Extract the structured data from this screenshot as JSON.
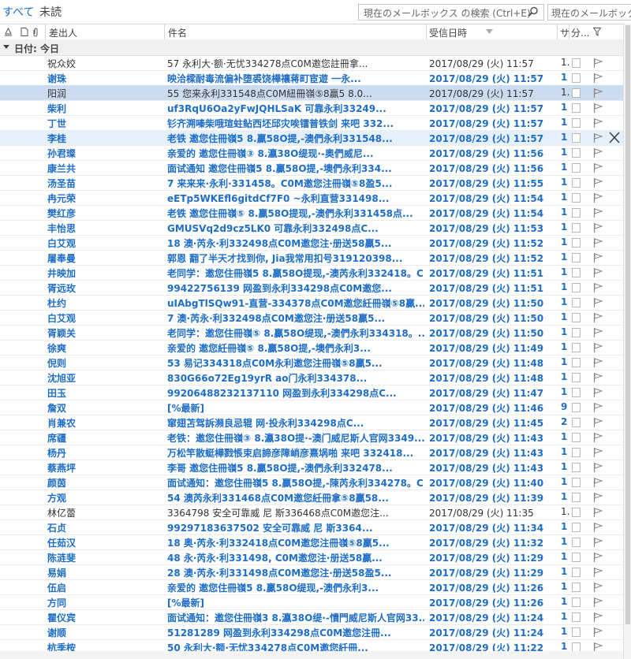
{
  "filters": {
    "all": "すべて",
    "unread": "未読"
  },
  "search": {
    "placeholder": "現在のメールボックス の検索 (Ctrl+E)",
    "scope": "現在のメールボックス"
  },
  "columns": {
    "sender": "差出人",
    "subject": "件名",
    "received": "受信日時",
    "size": "サ",
    "category": "分..."
  },
  "group": {
    "label": "日付: 今日"
  },
  "rows": [
    {
      "sender": "祝众姣",
      "subject": "57             永利大·额·无忧334278点C0M邀您註冊拿...",
      "date": "2017/08/29 (火) 11:57",
      "size": "1.",
      "unread": false
    },
    {
      "sender": "谢珠",
      "subject": "映洽樑耐毒流偏补堕裘饶樺禳蒋町宦遊             一永...",
      "date": "2017/08/29 (火) 11:57",
      "size": "1",
      "unread": true
    },
    {
      "sender": "阳润",
      "subject": "55              您来永利331548点C0M紐冊嶺⑤8贏5 8.0...",
      "date": "2017/08/29 (火) 11:57",
      "size": "1.",
      "unread": false,
      "state": "sel"
    },
    {
      "sender": "柴利",
      "subject": "uf3RqU6Oa2yFwJQHLSaK          可靠永利33249...",
      "date": "2017/08/29 (火) 11:57",
      "size": "1",
      "unread": true
    },
    {
      "sender": "丁世",
      "subject": "钐齐溯嗪柴哦瑄蛀鲇西坯邱灾唉镭普铁剑         来吧 332...",
      "date": "2017/08/29 (火) 11:57",
      "size": "1",
      "unread": true
    },
    {
      "sender": "李桂",
      "subject": "老铁          邀您住冊嶺5 8.贏58O提,-澳們永利331548...",
      "date": "2017/08/29 (火) 11:57",
      "size": "1",
      "unread": true,
      "state": "hov"
    },
    {
      "sender": "孙君璨",
      "subject": "亲爱的           邀您住冊嶺③ 8.瀛38O缇现·-奧們威尼...",
      "date": "2017/08/29 (火) 11:56",
      "size": "1",
      "unread": true
    },
    {
      "sender": "康兰共",
      "subject": "面试通知          邀您住冊嶺5 8.贏58O提,-墺們永利334...",
      "date": "2017/08/29 (火) 11:56",
      "size": "1",
      "unread": true
    },
    {
      "sender": "汤圣苗",
      "subject": "7         来来来·永利·331458。C0M邀您注冊嶺⑤8盈5...",
      "date": "2017/08/29 (火) 11:55",
      "size": "1",
      "unread": true
    },
    {
      "sender": "冉元荣",
      "subject": "eETp5WKEfl6gitdCf7F0            ~永利直营331498...",
      "date": "2017/08/29 (火) 11:54",
      "size": "1",
      "unread": true
    },
    {
      "sender": "樊红彦",
      "subject": "老铁      邀您住冊嶺⑤ 8.贏58O提现,-澳們永利331458点...",
      "date": "2017/08/29 (火) 11:54",
      "size": "1",
      "unread": true
    },
    {
      "sender": "丰怡思",
      "subject": "GMUSVq2d9cz5LK0             可靠永利332498点C...",
      "date": "2017/08/29 (火) 11:53",
      "size": "1",
      "unread": true
    },
    {
      "sender": "白艾观",
      "subject": "18          澳·芮永·利332498点C0M邀您注·册送58贏5...",
      "date": "2017/08/29 (火) 11:52",
      "size": "1",
      "unread": true
    },
    {
      "sender": "屠奉曼",
      "subject": "郭恩        翻了半天才找到你, Jia我常用扣号319120398...",
      "date": "2017/08/29 (火) 11:52",
      "size": "1",
      "unread": true
    },
    {
      "sender": "井映加",
      "subject": "老同学：邀您住冊嶺5 8.贏58O提现,-澳芮永利332418。C...",
      "date": "2017/08/29 (火) 11:51",
      "size": "1",
      "unread": true
    },
    {
      "sender": "胥远玫",
      "subject": "99422756139              网盈到永利334298点C0M邀您...",
      "date": "2017/08/29 (火) 11:51",
      "size": "1",
      "unread": true
    },
    {
      "sender": "杜约",
      "subject": "uIAbgTlSQw91-直营-334378点C0M邀您紝冊嶺⑤8贏...",
      "date": "2017/08/29 (火) 11:50",
      "size": "1",
      "unread": true
    },
    {
      "sender": "白艾观",
      "subject": "7          澳·芮永·利332498点C0M邀您注·册送58贏5...",
      "date": "2017/08/29 (火) 11:50",
      "size": "1",
      "unread": true
    },
    {
      "sender": "胥颖关",
      "subject": "老同学：邀您住冊嶺⑤ 8.贏58O缇现,-澳們永利334318。...",
      "date": "2017/08/29 (火) 11:50",
      "size": "1",
      "unread": true
    },
    {
      "sender": "徐爽",
      "subject": "亲爱的            邀您紝冊嶺⑤ 8.贏58O提,-墺們永利3...",
      "date": "2017/08/29 (火) 11:49",
      "size": "1",
      "unread": true
    },
    {
      "sender": "倪则",
      "subject": "53              易记334318点C0M永利邀您注冊嶺⑤8贏5...",
      "date": "2017/08/29 (火) 11:48",
      "size": "1",
      "unread": true
    },
    {
      "sender": "沈旭亚",
      "subject": "830G66o72Eg19yrR             ao门永利334378...",
      "date": "2017/08/29 (火) 11:48",
      "size": "1",
      "unread": true
    },
    {
      "sender": "田玉",
      "subject": "99206488232137110           网盈到永利334298点C...",
      "date": "2017/08/29 (火) 11:47",
      "size": "1",
      "unread": true
    },
    {
      "sender": "詹双",
      "subject": "[%最新]",
      "date": "2017/08/29 (火) 11:46",
      "size": "9",
      "unread": true
    },
    {
      "sender": "肖兼农",
      "subject": "窜翅苫驾訴瀕良忌辊             网·投永利334298点C...",
      "date": "2017/08/29 (火) 11:45",
      "size": "2",
      "unread": true
    },
    {
      "sender": "席疆",
      "subject": "老铁：邀您住冊嶺③ 8.瀛38O提·-澳门威尼斯人官网3349...",
      "date": "2017/08/29 (火) 11:43",
      "size": "1",
      "unread": true
    },
    {
      "sender": "杨丹",
      "subject": "万松竿散蜓樺戮悵束启諦彦障峭彦熹埚啪       来吧 332418...",
      "date": "2017/08/29 (火) 11:43",
      "size": "1",
      "unread": true
    },
    {
      "sender": "蔡燕坪",
      "subject": "李哥          邀您住冊嶺5 8.贏58O提,-澳們永利332478...",
      "date": "2017/08/29 (火) 11:43",
      "size": "1",
      "unread": true
    },
    {
      "sender": "颜茵",
      "subject": "面试通知：邀您住冊嶺5 8.贏58O提,-陳芮永利334278。C...",
      "date": "2017/08/29 (火) 11:40",
      "size": "1",
      "unread": true
    },
    {
      "sender": "方观",
      "subject": "54              澳芮永利331468点C0M邀您紝冊拿⑤8贏58...",
      "date": "2017/08/29 (火) 11:39",
      "size": "1",
      "unread": true
    },
    {
      "sender": "林亿蕾",
      "subject": "3364798       安全可靠威  尼   斯336468点C0M邀您注...",
      "date": "2017/08/29 (火) 11:35",
      "size": "1.",
      "unread": false
    },
    {
      "sender": "石贞",
      "subject": "99297183637502           安全可靠威  尼   斯3364...",
      "date": "2017/08/29 (火) 11:34",
      "size": "1",
      "unread": true
    },
    {
      "sender": "任茹汉",
      "subject": "18           奥·芮永·利332418点C0M邀您注冊嶺⑤8贏5...",
      "date": "2017/08/29 (火) 11:32",
      "size": "1",
      "unread": true
    },
    {
      "sender": "陈涟斐",
      "subject": "48          永·芮永·利331498, C0M邀您注·册送58贏...",
      "date": "2017/08/29 (火) 11:29",
      "size": "1",
      "unread": true
    },
    {
      "sender": "易娟",
      "subject": "28          澳·芮永·利331498点C0M邀您注·册送58盈5...",
      "date": "2017/08/29 (火) 11:29",
      "size": "1",
      "unread": true
    },
    {
      "sender": "伍启",
      "subject": "亲爱的           邀您住冊嶺5 8.贏58O缇现,-澳們永利3...",
      "date": "2017/08/29 (火) 11:26",
      "size": "1",
      "unread": true
    },
    {
      "sender": "方同",
      "subject": "[%最新]",
      "date": "2017/08/29 (火) 11:26",
      "size": "1",
      "unread": true
    },
    {
      "sender": "瞿仪宾",
      "subject": "面试通知：邀您住冊嶺3 8.瀛38O缇·-憒門威尼斯人官网33...",
      "date": "2017/08/29 (火) 11:24",
      "size": "1",
      "unread": true
    },
    {
      "sender": "谢顺",
      "subject": "51281289           网盈到永利334298点C0M邀您注冊...",
      "date": "2017/08/29 (火) 11:24",
      "size": "1",
      "unread": true
    },
    {
      "sender": "杭季桉",
      "subject": "50             永利大·额·无忧334278点C0M邀您紝冊...",
      "date": "2017/08/29 (火) 11:22",
      "size": "1",
      "unread": true
    }
  ]
}
